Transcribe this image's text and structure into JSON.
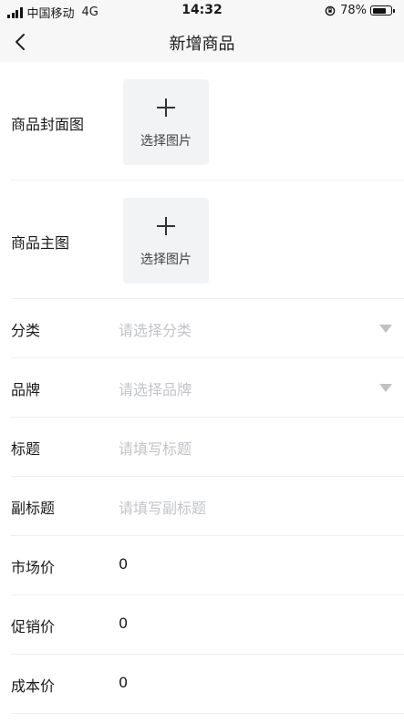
{
  "status_bar": {
    "carrier": "中国移动",
    "network": "4G",
    "time": "14:32",
    "battery": "78%",
    "battery_level": 0.78
  },
  "nav": {
    "title": "新增商品",
    "back_icon": "chevron-left-icon"
  },
  "form": {
    "cover_image": {
      "label": "商品封面图",
      "button_text": "选择图片"
    },
    "main_image": {
      "label": "商品主图",
      "button_text": "选择图片"
    },
    "fields": [
      {
        "label": "分类",
        "value": "",
        "placeholder": "请选择分类",
        "type": "select"
      },
      {
        "label": "品牌",
        "value": "",
        "placeholder": "请选择品牌",
        "type": "select"
      },
      {
        "label": "标题",
        "value": "",
        "placeholder": "请填写标题",
        "type": "text"
      },
      {
        "label": "副标题",
        "value": "",
        "placeholder": "请填写副标题",
        "type": "text"
      },
      {
        "label": "市场价",
        "value": "0",
        "placeholder": "",
        "type": "text"
      },
      {
        "label": "促销价",
        "value": "0",
        "placeholder": "",
        "type": "text"
      },
      {
        "label": "成本价",
        "value": "0",
        "placeholder": "",
        "type": "text"
      }
    ]
  },
  "colors": {
    "header_bg": "#f7f7f7",
    "upload_bg": "#f2f3f5",
    "placeholder": "#c2c4c8",
    "divider": "#efefef"
  }
}
